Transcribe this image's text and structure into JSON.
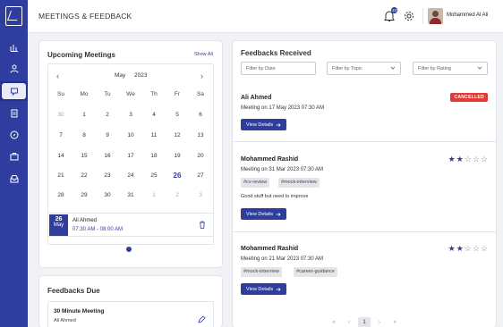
{
  "header": {
    "title": "MEETINGS & FEEDBACK",
    "notification_count": "10",
    "user_name": "Mohammed Al Ali"
  },
  "upcoming": {
    "title": "Upcoming Meetings",
    "show_all": "Show All",
    "calendar": {
      "month": "May",
      "year": "2023",
      "prev": "‹",
      "next": "›",
      "weekdays": [
        "Su",
        "Mo",
        "Tu",
        "We",
        "Th",
        "Fr",
        "Sa"
      ],
      "weeks": [
        [
          "30",
          "1",
          "2",
          "3",
          "4",
          "5",
          "6"
        ],
        [
          "7",
          "8",
          "9",
          "10",
          "11",
          "12",
          "13"
        ],
        [
          "14",
          "15",
          "16",
          "17",
          "18",
          "19",
          "20"
        ],
        [
          "21",
          "22",
          "23",
          "24",
          "25",
          "26",
          "27"
        ],
        [
          "28",
          "29",
          "30",
          "31",
          "1",
          "2",
          "3"
        ]
      ],
      "today": "26"
    },
    "meeting": {
      "day": "26",
      "month": "May",
      "name": "Ali Ahmed",
      "time": "07:30 AM - 08:00 AM"
    }
  },
  "due": {
    "title": "Feedbacks Due",
    "item": {
      "title": "30 Minute Meeting",
      "name": "Ali Ahmed"
    }
  },
  "received": {
    "title": "Feedbacks Received",
    "filters": {
      "date": "Filter by Date",
      "topic": "Filter by Topic",
      "rating": "Filter by Rating"
    },
    "view_details": "View Details",
    "items": [
      {
        "name": "Ali Ahmed",
        "meta": "Meeting on 17 May 2023 07:30 AM",
        "status": "CANCELLED"
      },
      {
        "name": "Mohammed Rashid",
        "meta": "Meeting on 31 Mar 2023 07:30 AM",
        "rating": 2,
        "tags": [
          "#cv-review",
          "#mock-interview"
        ],
        "comment": "Good stuff but need to improve"
      },
      {
        "name": "Mohammed Rashid",
        "meta": "Meeting on 21 Mar 2023 07:30 AM",
        "rating": 2,
        "tags": [
          "#mock-interview",
          "#career-guidance"
        ]
      }
    ],
    "pagination": {
      "first": "«",
      "prev": "‹",
      "current": "1",
      "next": "›",
      "last": "»"
    }
  },
  "colors": {
    "primary": "#2f3e9e",
    "cancelled": "#e53935",
    "background": "#f1f2f6"
  },
  "icons": [
    "app-logo-icon",
    "chart-icon",
    "user-icon",
    "chat-icon",
    "document-icon",
    "compass-icon",
    "briefcase-icon",
    "inbox-icon",
    "bell-icon",
    "gear-icon",
    "trash-icon",
    "arrow-right-icon",
    "chevron-down-icon",
    "star-icon",
    "edit-icon"
  ]
}
